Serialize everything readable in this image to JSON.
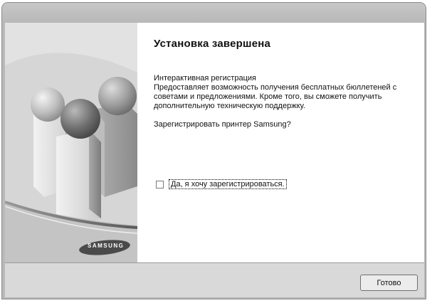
{
  "window": {
    "title": ""
  },
  "sidebar": {
    "logo_text": "SAMSUNG"
  },
  "main": {
    "heading": "Установка завершена",
    "description_lines": [
      "Интерактивная регистрация",
      "Предоставляет возможность получения бесплатных бюллетеней с",
      "советами и предложениями. Кроме того, вы сможете получить",
      "дополнительную техническую поддержку."
    ],
    "question": "Зарегистрировать принтер Samsung?",
    "register_checkbox": {
      "label": "Да, я хочу зарегистрироваться.",
      "checked": false
    }
  },
  "footer": {
    "done_label": "Готово"
  },
  "colors": {
    "background": "#d9d9d9",
    "content": "#ffffff",
    "sidebar_gray": "#cfcfcf"
  }
}
